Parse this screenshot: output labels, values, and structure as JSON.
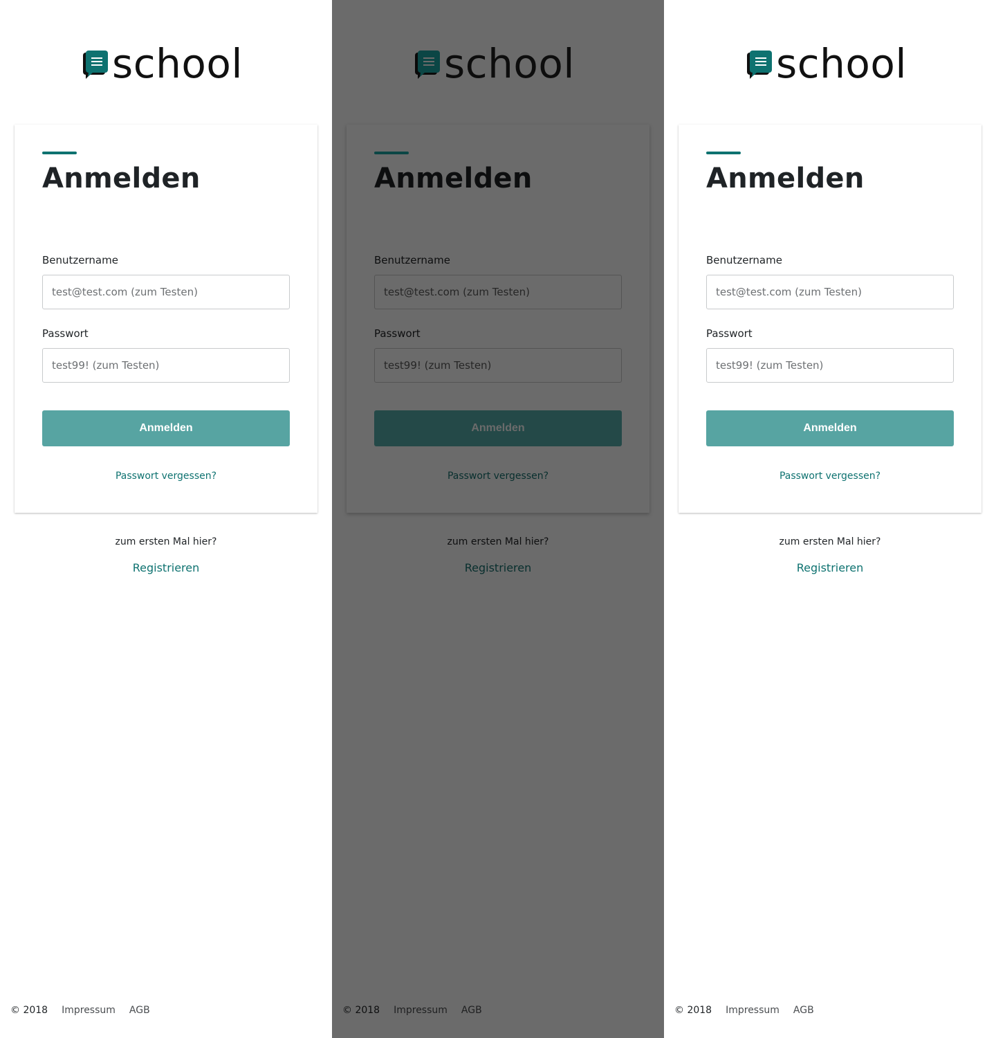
{
  "brand": {
    "logo_text": "school",
    "accent_color": "#0e7270",
    "button_color": "#57a4a2"
  },
  "login": {
    "title": "Anmelden",
    "username_label": "Benutzername",
    "username_placeholder": "test@test.com (zum Testen)",
    "password_label": "Passwort",
    "password_placeholder": "test99! (zum Testen)",
    "submit_label": "Anmelden",
    "forgot_password": "Passwort vergessen?"
  },
  "signup": {
    "prompt": "zum ersten Mal hier?",
    "register_label": "Registrieren"
  },
  "footer": {
    "copyright": "© 2018",
    "impressum": "Impressum",
    "agb": "AGB"
  },
  "panels": [
    {
      "state": "default",
      "overlay": false
    },
    {
      "state": "dimmed",
      "overlay": true
    },
    {
      "state": "default",
      "overlay": false
    }
  ]
}
